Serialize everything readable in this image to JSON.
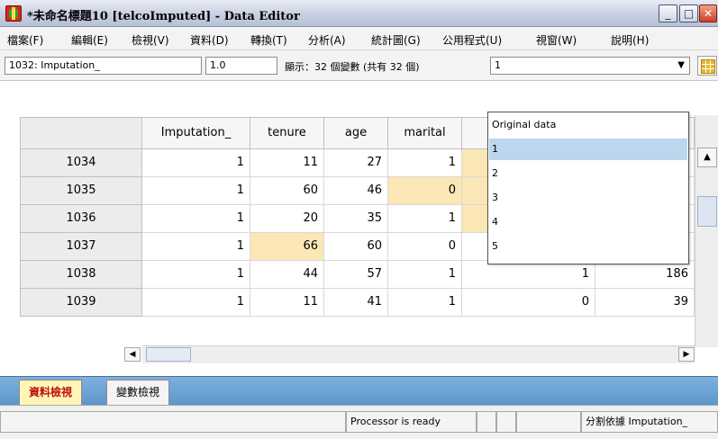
{
  "window": {
    "title": "*未命名標題10 [telcoImputed] - Data Editor",
    "minimize_glyph": "_",
    "maximize_glyph": "□",
    "close_glyph": "✕"
  },
  "menu": [
    "檔案(F)",
    "編輯(E)",
    "檢視(V)",
    "資料(D)",
    "轉換(T)",
    "分析(A)",
    "統計圖(G)",
    "公用程式(U)",
    "視窗(W)",
    "說明(H)"
  ],
  "cellbar": {
    "cell_ref": "1032: Imputation_",
    "cell_value": "1.0",
    "variable_count": "顯示：32 個變數 (共有 32 個)",
    "imputation_selected": "1"
  },
  "grid": {
    "columns": [
      "Imputation_",
      "tenure",
      "age",
      "marital"
    ],
    "rows": [
      {
        "id": "1034",
        "cells": [
          "1",
          "11",
          "27",
          "1",
          "",
          ""
        ],
        "imputed": [
          false,
          false,
          false,
          false,
          true,
          false
        ]
      },
      {
        "id": "1035",
        "cells": [
          "1",
          "60",
          "46",
          "0",
          "",
          ""
        ],
        "imputed": [
          false,
          false,
          false,
          true,
          true,
          false
        ]
      },
      {
        "id": "1036",
        "cells": [
          "1",
          "20",
          "35",
          "1",
          "",
          ""
        ],
        "imputed": [
          false,
          false,
          false,
          false,
          true,
          false
        ]
      },
      {
        "id": "1037",
        "cells": [
          "1",
          "66",
          "60",
          "0",
          "",
          ""
        ],
        "imputed": [
          false,
          true,
          false,
          false,
          false,
          false
        ]
      },
      {
        "id": "1038",
        "cells": [
          "1",
          "44",
          "57",
          "1",
          "1",
          "186"
        ],
        "imputed": [
          false,
          false,
          false,
          false,
          false,
          false
        ]
      },
      {
        "id": "1039",
        "cells": [
          "1",
          "11",
          "41",
          "1",
          "0",
          "39"
        ],
        "imputed": [
          false,
          false,
          false,
          false,
          false,
          false
        ]
      }
    ]
  },
  "dropdown": {
    "options": [
      "Original data",
      "1",
      "2",
      "3",
      "4",
      "5"
    ],
    "selected_index": 1
  },
  "tabs": {
    "data_view": "資料檢視",
    "variable_view": "變數檢視"
  },
  "status": {
    "processor": "Processor is ready",
    "split": "分割依據 Imputation_"
  },
  "colors": {
    "imputed_cell": "#fbe7b5",
    "selection": "#bcd6ee",
    "active_tab_text": "#c01010"
  }
}
